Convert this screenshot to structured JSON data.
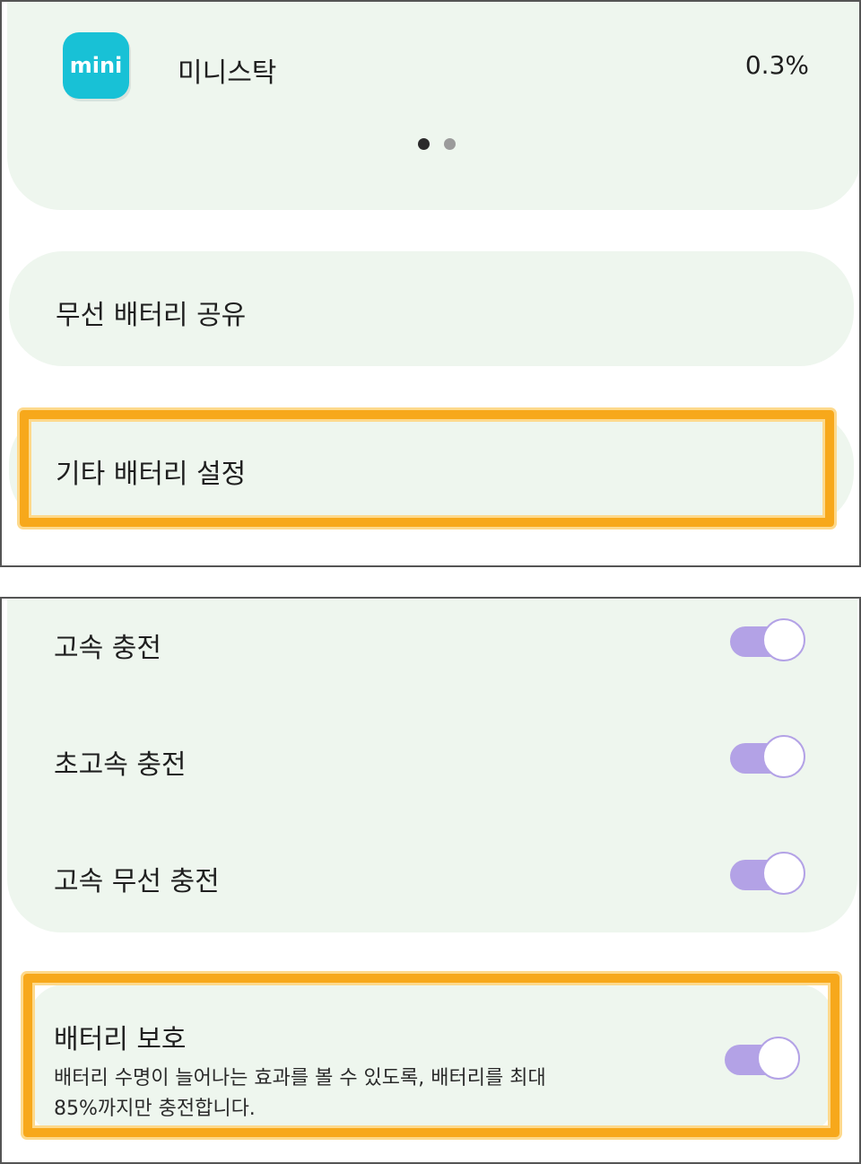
{
  "battery_usage": {
    "app": {
      "icon_text": "mini",
      "name": "미니스탁",
      "percent": "0.3%",
      "icon_color": "#18c1d6"
    },
    "page_indicator": {
      "current": 1,
      "total": 2
    }
  },
  "settings_menu": {
    "wireless_share_label": "무선 배터리 공유",
    "other_settings_label": "기타 배터리 설정"
  },
  "charging": {
    "items": [
      {
        "label": "고속 충전",
        "enabled": true
      },
      {
        "label": "초고속 충전",
        "enabled": true
      },
      {
        "label": "고속 무선 충전",
        "enabled": true
      }
    ]
  },
  "protect": {
    "title": "배터리 보호",
    "description_line1": "배터리 수명이 늘어나는 효과를 볼 수 있도록, 배터리를 최대",
    "description_line2": "85%까지만 충전합니다.",
    "enabled": true
  },
  "colors": {
    "card_bg": "#eef6ee",
    "highlight": "#f7a81b",
    "toggle_on": "#b3a2e6"
  }
}
